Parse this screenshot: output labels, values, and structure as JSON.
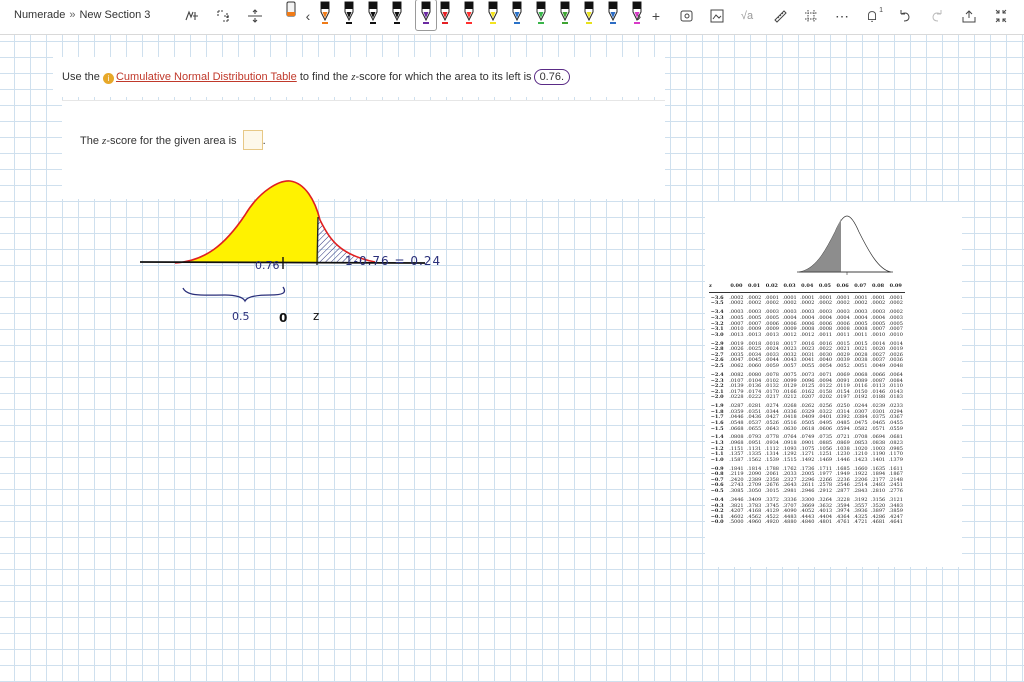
{
  "toolbar": {
    "breadcrumb": [
      "Numerade",
      "New Section 3"
    ],
    "breadcrumb_sep": "»",
    "pen_colors": [
      "#f07b17",
      "#111111",
      "#111111",
      "#111111",
      "#e51f24",
      "#ff2f2f",
      "#f3e31f",
      "#2a72c8",
      "#39b54a",
      "#3fa532",
      "#e7e11c",
      "#2c6cc4",
      "#d939c8"
    ],
    "selected_pen_color": "#6b2aa1",
    "icons_left": [
      "lasso-icon",
      "add-space-icon",
      "insert-space-icon",
      "eraser-icon",
      "pen-purple"
    ],
    "icons_right": [
      "ruler-icon",
      "image-icon",
      "math-icon",
      "lasso-select-icon",
      "grid-icon",
      "more-icon",
      "notification-icon",
      "undo-icon",
      "redo-icon",
      "share-icon",
      "collapse-icon"
    ],
    "notification_count": "1"
  },
  "question": {
    "prefix": "Use the",
    "link": "Cumulative Normal Distribution Table",
    "middle": "to find the",
    "z_letter": "z",
    "suffix": "-score for which the area to its left is",
    "value": "0.76."
  },
  "answer": {
    "prefix": "The",
    "z_letter": "z",
    "suffix": "-score for the given area is",
    "end": "."
  },
  "handwriting": {
    "area_left": "0.76",
    "complement": "1-0.76 = 0.24",
    "zero": "0",
    "z": "z",
    "half": "0.5"
  },
  "z_table": {
    "header": [
      "z",
      "0.00",
      "0.01",
      "0.02",
      "0.03",
      "0.04",
      "0.05",
      "0.06",
      "0.07",
      "0.08",
      "0.09"
    ],
    "groups": [
      [
        [
          "−3.6",
          ".0002",
          ".0002",
          ".0001",
          ".0001",
          ".0001",
          ".0001",
          ".0001",
          ".0001",
          ".0001",
          ".0001"
        ],
        [
          "−3.5",
          ".0002",
          ".0002",
          ".0002",
          ".0002",
          ".0002",
          ".0002",
          ".0002",
          ".0002",
          ".0002",
          ".0002"
        ]
      ],
      [
        [
          "−3.4",
          ".0003",
          ".0003",
          ".0003",
          ".0003",
          ".0003",
          ".0003",
          ".0003",
          ".0003",
          ".0003",
          ".0002"
        ],
        [
          "−3.3",
          ".0005",
          ".0005",
          ".0005",
          ".0004",
          ".0004",
          ".0004",
          ".0004",
          ".0004",
          ".0004",
          ".0003"
        ],
        [
          "−3.2",
          ".0007",
          ".0007",
          ".0006",
          ".0006",
          ".0006",
          ".0006",
          ".0006",
          ".0005",
          ".0005",
          ".0005"
        ],
        [
          "−3.1",
          ".0010",
          ".0009",
          ".0009",
          ".0009",
          ".0008",
          ".0008",
          ".0008",
          ".0008",
          ".0007",
          ".0007"
        ],
        [
          "−3.0",
          ".0013",
          ".0013",
          ".0013",
          ".0012",
          ".0012",
          ".0011",
          ".0011",
          ".0011",
          ".0010",
          ".0010"
        ]
      ],
      [
        [
          "−2.9",
          ".0019",
          ".0018",
          ".0018",
          ".0017",
          ".0016",
          ".0016",
          ".0015",
          ".0015",
          ".0014",
          ".0014"
        ],
        [
          "−2.8",
          ".0026",
          ".0025",
          ".0024",
          ".0023",
          ".0023",
          ".0022",
          ".0021",
          ".0021",
          ".0020",
          ".0019"
        ],
        [
          "−2.7",
          ".0035",
          ".0034",
          ".0033",
          ".0032",
          ".0031",
          ".0030",
          ".0029",
          ".0028",
          ".0027",
          ".0026"
        ],
        [
          "−2.6",
          ".0047",
          ".0045",
          ".0044",
          ".0043",
          ".0041",
          ".0040",
          ".0039",
          ".0038",
          ".0037",
          ".0036"
        ],
        [
          "−2.5",
          ".0062",
          ".0060",
          ".0059",
          ".0057",
          ".0055",
          ".0054",
          ".0052",
          ".0051",
          ".0049",
          ".0048"
        ]
      ],
      [
        [
          "−2.4",
          ".0082",
          ".0080",
          ".0078",
          ".0075",
          ".0073",
          ".0071",
          ".0069",
          ".0068",
          ".0066",
          ".0064"
        ],
        [
          "−2.3",
          ".0107",
          ".0104",
          ".0102",
          ".0099",
          ".0096",
          ".0094",
          ".0091",
          ".0089",
          ".0087",
          ".0084"
        ],
        [
          "−2.2",
          ".0139",
          ".0136",
          ".0132",
          ".0129",
          ".0125",
          ".0122",
          ".0119",
          ".0116",
          ".0113",
          ".0110"
        ],
        [
          "−2.1",
          ".0179",
          ".0174",
          ".0170",
          ".0166",
          ".0162",
          ".0158",
          ".0154",
          ".0150",
          ".0146",
          ".0143"
        ],
        [
          "−2.0",
          ".0228",
          ".0222",
          ".0217",
          ".0212",
          ".0207",
          ".0202",
          ".0197",
          ".0192",
          ".0188",
          ".0183"
        ]
      ],
      [
        [
          "−1.9",
          ".0287",
          ".0281",
          ".0274",
          ".0268",
          ".0262",
          ".0256",
          ".0250",
          ".0244",
          ".0239",
          ".0233"
        ],
        [
          "−1.8",
          ".0359",
          ".0351",
          ".0344",
          ".0336",
          ".0329",
          ".0322",
          ".0314",
          ".0307",
          ".0301",
          ".0294"
        ],
        [
          "−1.7",
          ".0446",
          ".0436",
          ".0427",
          ".0418",
          ".0409",
          ".0401",
          ".0392",
          ".0384",
          ".0375",
          ".0367"
        ],
        [
          "−1.6",
          ".0548",
          ".0537",
          ".0526",
          ".0516",
          ".0505",
          ".0495",
          ".0485",
          ".0475",
          ".0465",
          ".0455"
        ],
        [
          "−1.5",
          ".0668",
          ".0655",
          ".0643",
          ".0630",
          ".0618",
          ".0606",
          ".0594",
          ".0582",
          ".0571",
          ".0559"
        ]
      ],
      [
        [
          "−1.4",
          ".0808",
          ".0793",
          ".0778",
          ".0764",
          ".0749",
          ".0735",
          ".0721",
          ".0708",
          ".0694",
          ".0681"
        ],
        [
          "−1.3",
          ".0968",
          ".0951",
          ".0934",
          ".0918",
          ".0901",
          ".0885",
          ".0869",
          ".0853",
          ".0838",
          ".0823"
        ],
        [
          "−1.2",
          ".1151",
          ".1131",
          ".1112",
          ".1093",
          ".1075",
          ".1056",
          ".1038",
          ".1020",
          ".1003",
          ".0985"
        ],
        [
          "−1.1",
          ".1357",
          ".1335",
          ".1314",
          ".1292",
          ".1271",
          ".1251",
          ".1230",
          ".1210",
          ".1190",
          ".1170"
        ],
        [
          "−1.0",
          ".1587",
          ".1562",
          ".1539",
          ".1515",
          ".1492",
          ".1469",
          ".1446",
          ".1423",
          ".1401",
          ".1379"
        ]
      ],
      [
        [
          "−0.9",
          ".1841",
          ".1814",
          ".1788",
          ".1762",
          ".1736",
          ".1711",
          ".1685",
          ".1660",
          ".1635",
          ".1611"
        ],
        [
          "−0.8",
          ".2119",
          ".2090",
          ".2061",
          ".2033",
          ".2005",
          ".1977",
          ".1949",
          ".1922",
          ".1894",
          ".1867"
        ],
        [
          "−0.7",
          ".2420",
          ".2389",
          ".2358",
          ".2327",
          ".2296",
          ".2266",
          ".2236",
          ".2206",
          ".2177",
          ".2148"
        ],
        [
          "−0.6",
          ".2743",
          ".2709",
          ".2676",
          ".2643",
          ".2611",
          ".2578",
          ".2546",
          ".2514",
          ".2483",
          ".2451"
        ],
        [
          "−0.5",
          ".3085",
          ".3050",
          ".3015",
          ".2981",
          ".2946",
          ".2912",
          ".2877",
          ".2843",
          ".2810",
          ".2776"
        ]
      ],
      [
        [
          "−0.4",
          ".3446",
          ".3409",
          ".3372",
          ".3336",
          ".3300",
          ".3264",
          ".3228",
          ".3192",
          ".3156",
          ".3121"
        ],
        [
          "−0.3",
          ".3821",
          ".3783",
          ".3745",
          ".3707",
          ".3669",
          ".3632",
          ".3594",
          ".3557",
          ".3520",
          ".3483"
        ],
        [
          "−0.2",
          ".4207",
          ".4168",
          ".4129",
          ".4090",
          ".4052",
          ".4013",
          ".3974",
          ".3936",
          ".3897",
          ".3859"
        ],
        [
          "−0.1",
          ".4602",
          ".4562",
          ".4522",
          ".4483",
          ".4443",
          ".4404",
          ".4364",
          ".4325",
          ".4286",
          ".4247"
        ],
        [
          "−0.0",
          ".5000",
          ".4960",
          ".4920",
          ".4880",
          ".4840",
          ".4801",
          ".4761",
          ".4721",
          ".4681",
          ".4641"
        ]
      ]
    ]
  }
}
